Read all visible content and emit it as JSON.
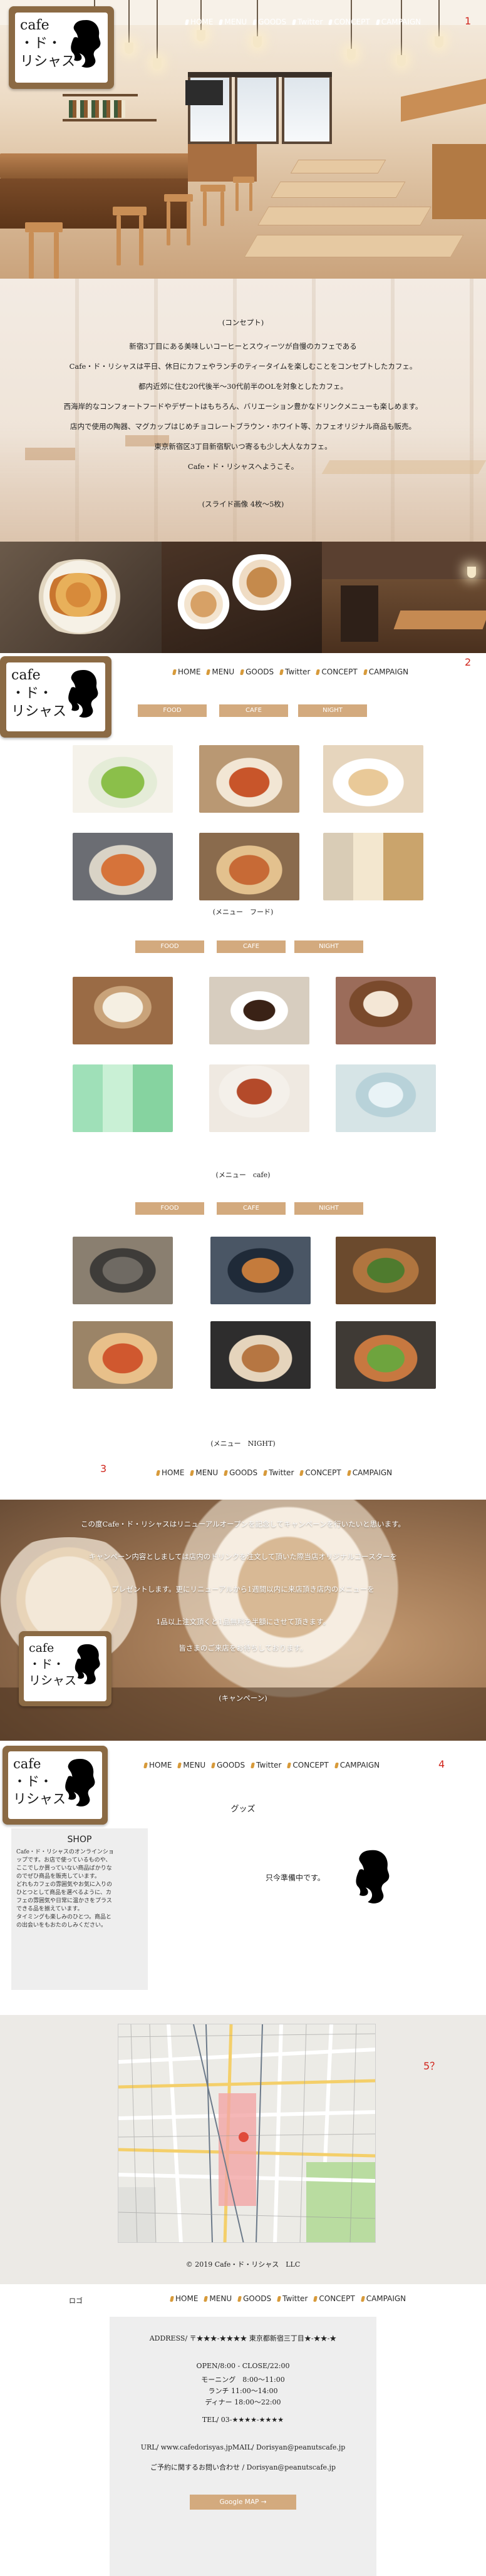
{
  "logo": {
    "text": "cafe\n・ド・\nリシャス"
  },
  "nav": {
    "home": "HOME",
    "menu": "MENU",
    "goods": "GOODS",
    "twitter": "Twitter",
    "concept": "CONCEPT",
    "campaign": "CAMPAIGN"
  },
  "markers": {
    "m1": "1",
    "m2": "2",
    "m3": "3",
    "m4": "4",
    "m5": "5？"
  },
  "concept": {
    "heading": "(コンセプト)",
    "lines": [
      "新宿3丁目にある美味しいコーヒーとスウィーツが自慢のカフェである",
      "Cafe・ド・リシャスは平日、休日にカフェやランチのティータイムを楽しむことをコンセプトしたカフェ。",
      "都内近郊に住む20代後半～30代前半のOLを対象としたカフェ。",
      "西海岸的なコンフォートフードやデザートはもちろん、バリエーション豊かなドリンクメニューも楽しめます。",
      "店内で使用の陶器、マグカップはじめチョコレートブラウン・ホワイト等、カフェオリジナル商品も販売。",
      "東京新宿区3丁目新宿駅いつ寄るも少し大人なカフェ。",
      "Cafe・ド・リシャスへようこそ。"
    ],
    "slide_note": "(スライド画像 4枚〜5枚)"
  },
  "menu": {
    "tabs": [
      "FOOD",
      "CAFE",
      "NIGHT"
    ],
    "captions": [
      "(メニュー　フード)",
      "(メニュー　cafe)",
      "(メニュー　NIGHT)"
    ]
  },
  "campaign": {
    "lines": [
      "この度Cafe・ド・リシャスはリニューアルオープンを記念してキャンペーンを行いたいと思います。",
      "キャンペーン内容としましては店内のドリンクを注文して頂いた際当店オリジナルコースターを",
      "プレゼントします。更にリニューアルから1週間以内に来店頂き店内のメニューを",
      "1品以上注文頂くと1品無料を半額にさせて頂きます。",
      "皆さまのご来店をお待ちしております。"
    ],
    "note": "(キャンペーン)"
  },
  "goods": {
    "title": "グッズ",
    "preparing": "只今準備中です。",
    "shop_title": "SHOP",
    "shop_text": "Cafe・ド・リシャスのオンラインショップです。お店で使っているものや、ここでしか買っていない商品ばかりなのでぜひ商品を販売しています。\nどれもカフェの雰囲気やお気に入りのひとつとして商品を選べるように、カフェの雰囲気や日常に温かさをプラスできる品を揃えています。\nタイミングも楽しみのひとつ。商品との出会いをもおたのしみください。"
  },
  "map": {
    "copyright": "© 2019 Cafe・ド・リシャス　LLC"
  },
  "footer": {
    "logo_label": "ロゴ",
    "address": "ADDRESS/ 〒★★★-★★★★ 東京都新宿三丁目★-★★-★",
    "open": "OPEN/8:00 - CLOSE/22:00",
    "morning": "モーニング　8:00〜11:00",
    "lunch": "ランチ 11:00〜14:00",
    "dinner": "ディナー 18:00〜22:00",
    "tel": "TEL/ 03-★★★★-★★★★",
    "url": "URL/ www.cafedorisyas.jpMAIL/ Dorisyan@peanutscafe.jp",
    "contact": "ご予約に関するお問い合わせ / Dorisyan@peanutscafe.jp",
    "google_map": "Google MAP"
  }
}
